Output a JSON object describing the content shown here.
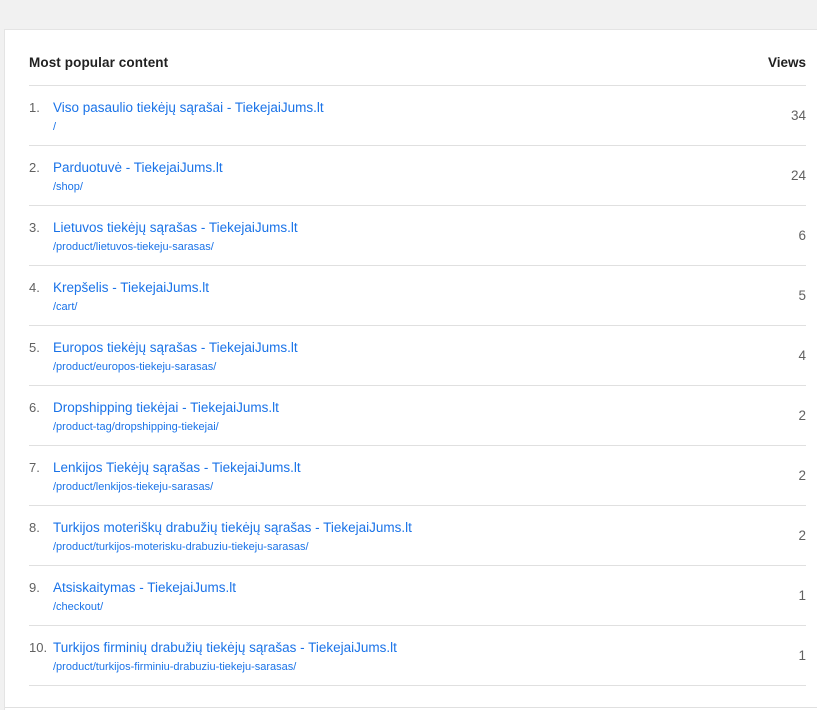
{
  "card": {
    "title": "Most popular content",
    "views_label": "Views"
  },
  "rows": [
    {
      "num": "1.",
      "title": "Viso pasaulio tiekėjų sąrašai - TiekejaiJums.lt",
      "path": "/",
      "views": "34"
    },
    {
      "num": "2.",
      "title": "Parduotuvė - TiekejaiJums.lt",
      "path": "/shop/",
      "views": "24"
    },
    {
      "num": "3.",
      "title": "Lietuvos tiekėjų sąrašas - TiekejaiJums.lt",
      "path": "/product/lietuvos-tiekeju-sarasas/",
      "views": "6"
    },
    {
      "num": "4.",
      "title": "Krepšelis - TiekejaiJums.lt",
      "path": "/cart/",
      "views": "5"
    },
    {
      "num": "5.",
      "title": "Europos tiekėjų sąrašas - TiekejaiJums.lt",
      "path": "/product/europos-tiekeju-sarasas/",
      "views": "4"
    },
    {
      "num": "6.",
      "title": "Dropshipping tiekėjai - TiekejaiJums.lt",
      "path": "/product-tag/dropshipping-tiekejai/",
      "views": "2"
    },
    {
      "num": "7.",
      "title": "Lenkijos Tiekėjų sąrašas - TiekejaiJums.lt",
      "path": "/product/lenkijos-tiekeju-sarasas/",
      "views": "2"
    },
    {
      "num": "8.",
      "title": "Turkijos moteriškų drabužių tiekėjų sąrašas - TiekejaiJums.lt",
      "path": "/product/turkijos-moterisku-drabuziu-tiekeju-sarasas/",
      "views": "2"
    },
    {
      "num": "9.",
      "title": "Atsiskaitymas - TiekejaiJums.lt",
      "path": "/checkout/",
      "views": "1"
    },
    {
      "num": "10.",
      "title": "Turkijos firminių drabužių tiekėjų sąrašas - TiekejaiJums.lt",
      "path": "/product/turkijos-firminiu-drabuziu-tiekeju-sarasas/",
      "views": "1"
    }
  ]
}
